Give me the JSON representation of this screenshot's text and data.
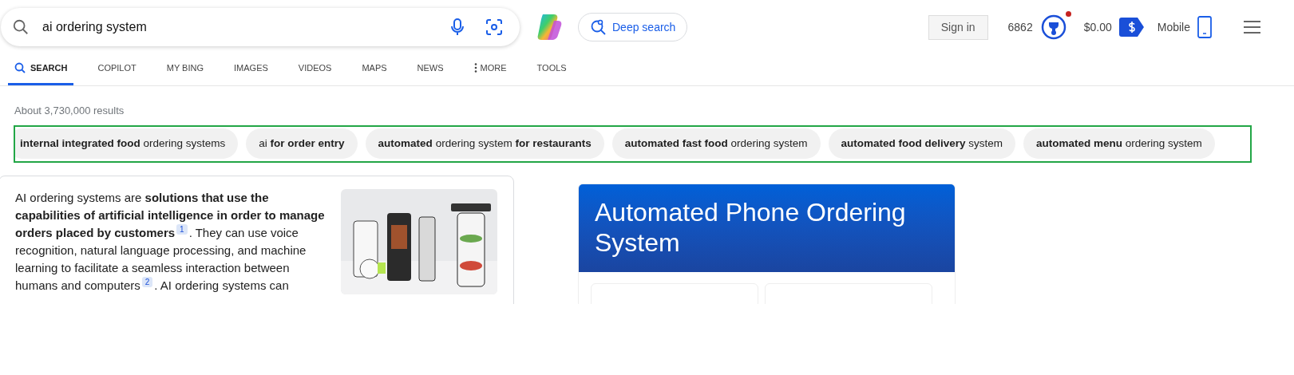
{
  "search": {
    "value": "ai ordering system"
  },
  "deep_search": {
    "label": "Deep search"
  },
  "header": {
    "sign_in": "Sign in",
    "points": "6862",
    "rewards_notification": true,
    "balance": "$0.00",
    "mobile": "Mobile"
  },
  "tabs": [
    {
      "label": "SEARCH",
      "selected": true,
      "kind": "search"
    },
    {
      "label": "COPILOT",
      "selected": false,
      "kind": "plain"
    },
    {
      "label": "MY BING",
      "selected": false,
      "kind": "plain"
    },
    {
      "label": "IMAGES",
      "selected": false,
      "kind": "plain"
    },
    {
      "label": "VIDEOS",
      "selected": false,
      "kind": "plain"
    },
    {
      "label": "MAPS",
      "selected": false,
      "kind": "plain"
    },
    {
      "label": "NEWS",
      "selected": false,
      "kind": "plain"
    },
    {
      "label": "MORE",
      "selected": false,
      "kind": "more"
    },
    {
      "label": "TOOLS",
      "selected": false,
      "kind": "plain"
    }
  ],
  "result_count": "About 3,730,000 results",
  "related_searches": [
    "**internal integrated food** ordering systems",
    "ai **for order entry**",
    "**automated** ordering system **for restaurants**",
    "**automated fast food** ordering system",
    "**automated food delivery** system",
    "**automated menu** ordering system"
  ],
  "answer": {
    "segments": [
      {
        "kind": "text",
        "text": "AI ordering systems are **solutions that use the capabilities of artificial intelligence in order to manage orders placed by customers**"
      },
      {
        "kind": "citation",
        "text": "1"
      },
      {
        "kind": "text",
        "text": ". They can use voice recognition, natural language processing, and machine learning to facilitate a seamless interaction between humans and computers"
      },
      {
        "kind": "citation",
        "text": "2"
      },
      {
        "kind": "text",
        "text": ". AI ordering systems can"
      }
    ]
  },
  "side_panel": {
    "title": "Automated Phone Ordering System"
  }
}
